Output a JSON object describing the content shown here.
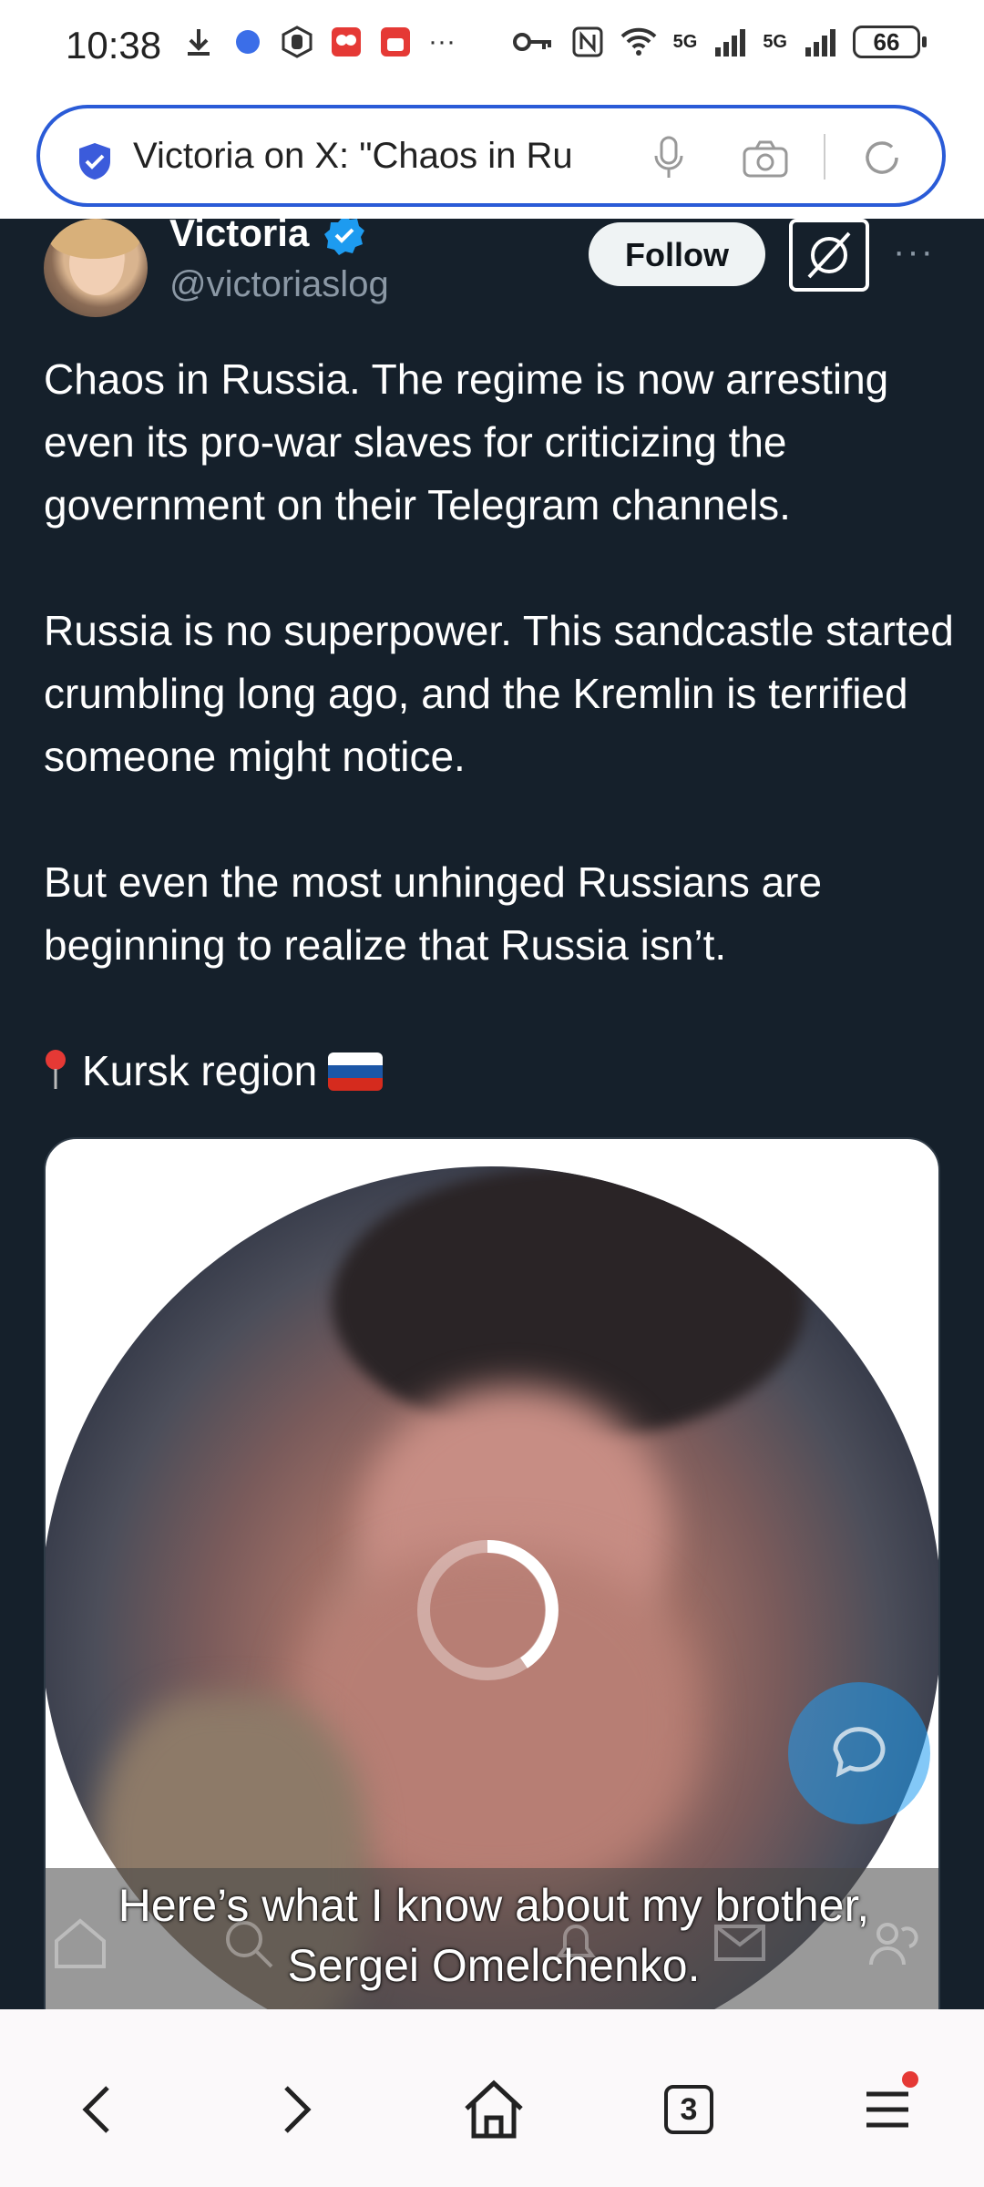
{
  "status_bar": {
    "time": "10:38",
    "battery": "66",
    "network_label_1": "5G",
    "network_label_2": "5G",
    "more_indicator": "···"
  },
  "address_bar": {
    "page_title": "Victoria on X: \"Chaos in Ru"
  },
  "tweet": {
    "author_name": "Victoria",
    "author_handle": "@victoriaslog",
    "follow_label": "Follow",
    "more_label": "···",
    "paragraphs": [
      "Chaos in Russia. The regime is now arresting even its pro-war slaves for criticizing the government on their Telegram channels.",
      "Russia is no superpower. This sandcastle started crumbling long ago, and the Kremlin is terrified someone might notice.",
      "But even the most unhinged Russians are beginning to realize that Russia isn’t."
    ],
    "location": "Kursk region"
  },
  "video": {
    "caption_line1": "Here’s what I know about my brother,",
    "caption_line2": "Sergei Omelchenko."
  },
  "bottom_nav": {
    "tabs_count": "3"
  },
  "colors": {
    "background": "#15202b",
    "accent": "#1d9bf0",
    "url_border": "#2a5bd7"
  }
}
